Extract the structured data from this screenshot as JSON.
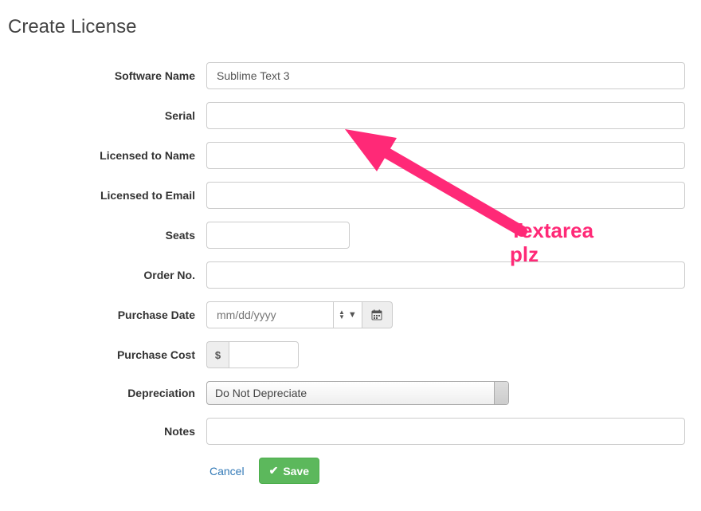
{
  "title": "Create License",
  "labels": {
    "software_name": "Software Name",
    "serial": "Serial",
    "licensed_to_name": "Licensed to Name",
    "licensed_to_email": "Licensed to Email",
    "seats": "Seats",
    "order_no": "Order No.",
    "purchase_date": "Purchase Date",
    "purchase_cost": "Purchase Cost",
    "depreciation": "Depreciation",
    "notes": "Notes"
  },
  "values": {
    "software_name": "Sublime Text 3",
    "serial": "",
    "licensed_to_name": "",
    "licensed_to_email": "",
    "seats": "",
    "order_no": "",
    "purchase_date_placeholder": "mm/dd/yyyy",
    "purchase_cost": "",
    "currency_symbol": "$",
    "depreciation_selected": "Do Not Depreciate",
    "notes": ""
  },
  "actions": {
    "cancel": "Cancel",
    "save": "Save"
  },
  "annotation": {
    "text_line1": "Textarea",
    "text_line2": "plz"
  }
}
